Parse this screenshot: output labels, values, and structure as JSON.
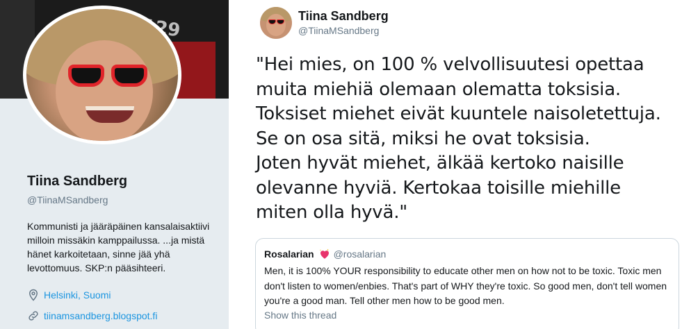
{
  "profile": {
    "banner_text": "129",
    "name": "Tiina Sandberg",
    "handle": "@TiinaMSandberg",
    "bio": "Kommunisti ja jääräpäinen kansalaisaktiivi milloin missäkin kamppailussa. ...ja mistä hänet karkoitetaan, sinne jää yhä levottomuus. SKP:n pääsihteeri.",
    "location": "Helsinki, Suomi",
    "url": "tiinamsandberg.blogspot.fi",
    "location_icon": "location-pin-icon",
    "url_icon": "link-icon"
  },
  "tweet": {
    "name": "Tiina Sandberg",
    "handle": "@TiinaMSandberg",
    "text": "\"Hei mies, on 100 % velvollisuutesi opettaa\nmuita miehiä olemaan olematta toksisia.\nToksiset miehet eivät kuuntele naisoletettuja.\nSe on osa sitä, miksi he ovat toksisia.\nJoten hyvät miehet, älkää kertoko naisille\nolevanne hyviä. Kertokaa toisille miehille\nmiten olla hyvä.\""
  },
  "quoted_tweet": {
    "name": "Rosalarian",
    "emoji_icon": "sparkling-heart-icon",
    "handle": "@rosalarian",
    "text": "Men, it is 100% YOUR responsibility to educate other men on how not to be toxic. Toxic men don't listen to women/enbies. That's part of WHY they're toxic. So good men, don't tell women you're a good man. Tell other men how to be good men.",
    "show_thread": "Show this thread"
  },
  "colors": {
    "link": "#1b95e0",
    "secondary_text": "#657786",
    "card_bg": "#e6ecf0",
    "border": "#ccd6dd"
  }
}
